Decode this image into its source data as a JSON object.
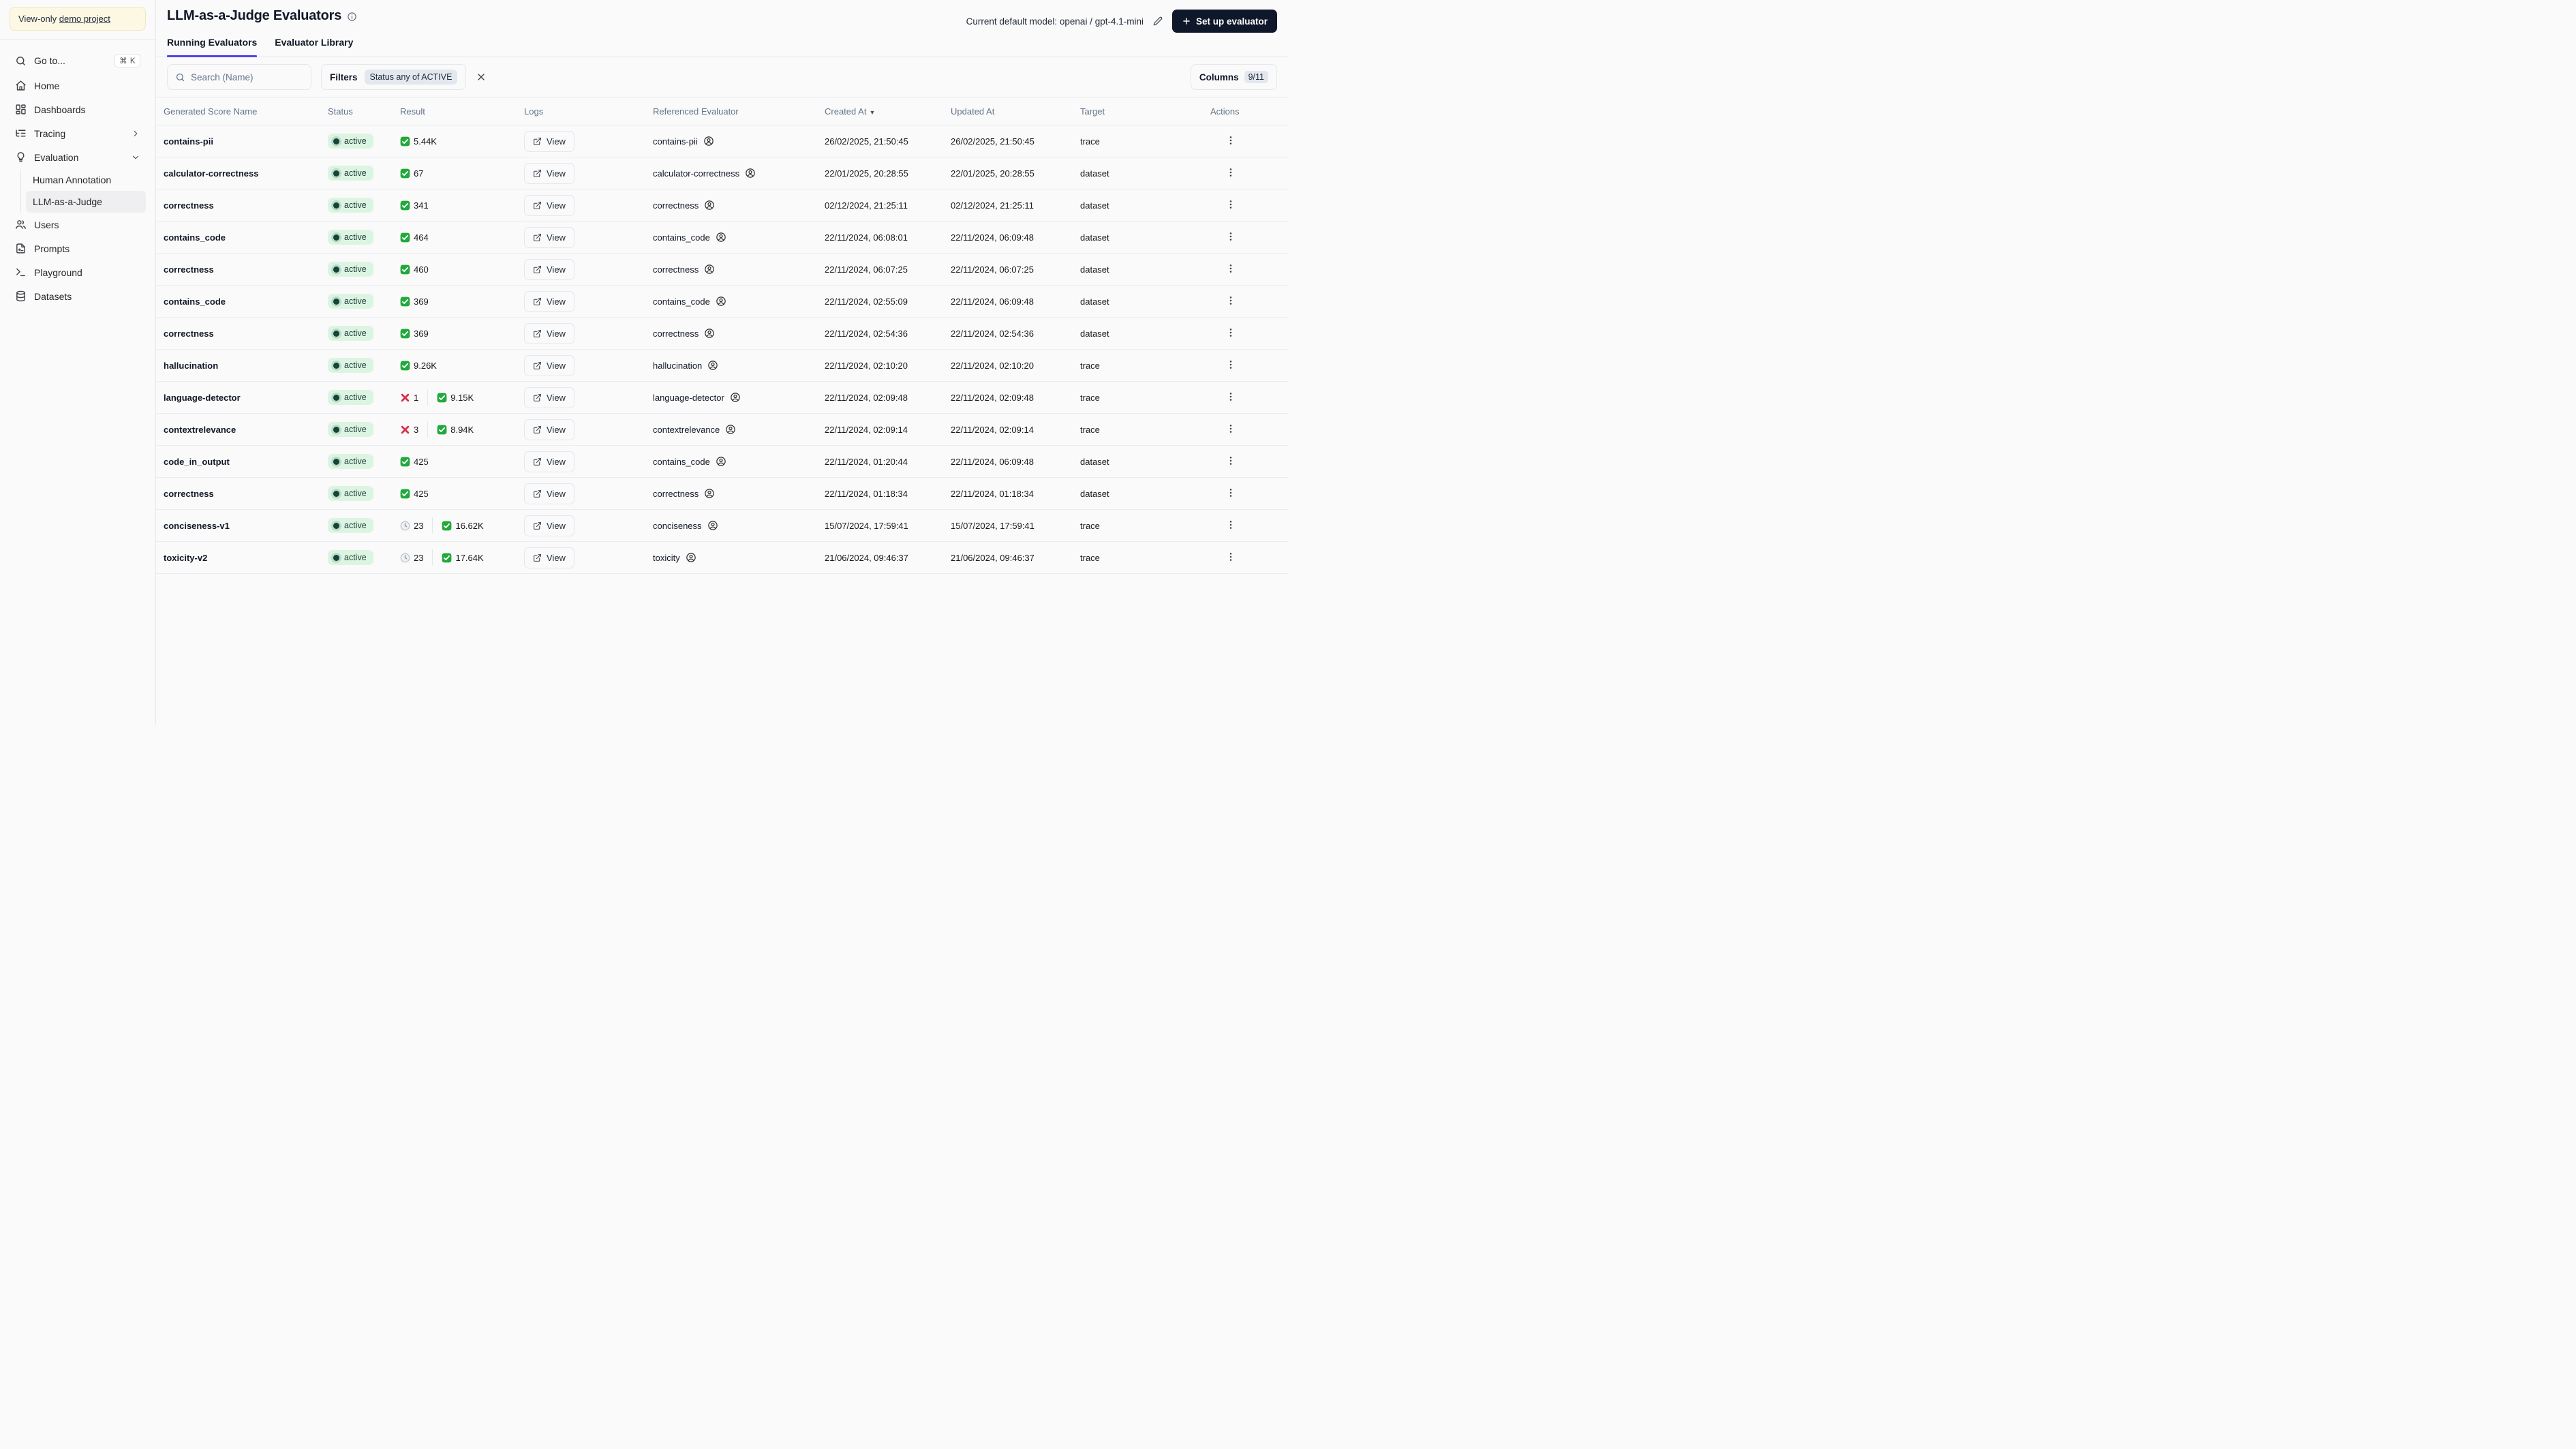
{
  "colors": {
    "accent": "#4f46e5",
    "primary_button_bg": "#0f172a",
    "status_badge_bg": "#dcf5e3",
    "status_dot": "#17433a",
    "result_check_green": "#23a83c",
    "result_cross_red": "#dd2e44",
    "banner_bg": "#fdf8e3",
    "pill_bg": "#e3e8ef"
  },
  "sidebar": {
    "banner": {
      "prefix": "View-only",
      "link_label": "demo project"
    },
    "items": [
      {
        "id": "goto",
        "label": "Go to...",
        "icon": "search",
        "shortcut": "⌘ K"
      },
      {
        "id": "home",
        "label": "Home",
        "icon": "home"
      },
      {
        "id": "dashboards",
        "label": "Dashboards",
        "icon": "dashboard"
      },
      {
        "id": "tracing",
        "label": "Tracing",
        "icon": "list-tree",
        "chevron": "right"
      },
      {
        "id": "evaluation",
        "label": "Evaluation",
        "icon": "lightbulb",
        "chevron": "down",
        "children": [
          {
            "id": "human-annotation",
            "label": "Human Annotation",
            "active": false
          },
          {
            "id": "llm-as-a-judge",
            "label": "LLM-as-a-Judge",
            "active": true
          }
        ]
      },
      {
        "id": "users",
        "label": "Users",
        "icon": "users"
      },
      {
        "id": "prompts",
        "label": "Prompts",
        "icon": "file"
      },
      {
        "id": "playground",
        "label": "Playground",
        "icon": "terminal"
      },
      {
        "id": "datasets",
        "label": "Datasets",
        "icon": "database"
      }
    ]
  },
  "header": {
    "title": "LLM-as-a-Judge Evaluators",
    "title_info_icon": "info",
    "model_label": "Current default model: openai / gpt-4.1-mini",
    "edit_icon": "pencil",
    "setup_button_icon": "plus",
    "setup_button_label": "Set up evaluator"
  },
  "tabs": [
    {
      "label": "Running Evaluators",
      "active": true
    },
    {
      "label": "Evaluator Library",
      "active": false
    }
  ],
  "toolbar": {
    "search_icon": "search",
    "search_placeholder": "Search (Name)",
    "filters_label": "Filters",
    "filter_badge": "Status any of ACTIVE",
    "clear_filter_icon": "x",
    "columns_label": "Columns",
    "columns_badge": "9/11"
  },
  "table": {
    "columns": [
      "Generated Score Name",
      "Status",
      "Result",
      "Logs",
      "Referenced Evaluator",
      "Created At",
      "Updated At",
      "Target",
      "Actions"
    ],
    "sort_column": "Created At",
    "sort_indicator": "▼",
    "logs_button_label": "View",
    "rows": [
      {
        "name": "contains-pii",
        "status": "active",
        "result": [
          {
            "icon": "check",
            "value": "5.44K"
          }
        ],
        "referenced": "contains-pii",
        "created": "26/02/2025, 21:50:45",
        "updated": "26/02/2025, 21:50:45",
        "target": "trace"
      },
      {
        "name": "calculator-correctness",
        "status": "active",
        "result": [
          {
            "icon": "check",
            "value": "67"
          }
        ],
        "referenced": "calculator-correctness",
        "created": "22/01/2025, 20:28:55",
        "updated": "22/01/2025, 20:28:55",
        "target": "dataset"
      },
      {
        "name": "correctness",
        "status": "active",
        "result": [
          {
            "icon": "check",
            "value": "341"
          }
        ],
        "referenced": "correctness",
        "created": "02/12/2024, 21:25:11",
        "updated": "02/12/2024, 21:25:11",
        "target": "dataset"
      },
      {
        "name": "contains_code",
        "status": "active",
        "result": [
          {
            "icon": "check",
            "value": "464"
          }
        ],
        "referenced": "contains_code",
        "created": "22/11/2024, 06:08:01",
        "updated": "22/11/2024, 06:09:48",
        "target": "dataset"
      },
      {
        "name": "correctness",
        "status": "active",
        "result": [
          {
            "icon": "check",
            "value": "460"
          }
        ],
        "referenced": "correctness",
        "created": "22/11/2024, 06:07:25",
        "updated": "22/11/2024, 06:07:25",
        "target": "dataset"
      },
      {
        "name": "contains_code",
        "status": "active",
        "result": [
          {
            "icon": "check",
            "value": "369"
          }
        ],
        "referenced": "contains_code",
        "created": "22/11/2024, 02:55:09",
        "updated": "22/11/2024, 06:09:48",
        "target": "dataset"
      },
      {
        "name": "correctness",
        "status": "active",
        "result": [
          {
            "icon": "check",
            "value": "369"
          }
        ],
        "referenced": "correctness",
        "created": "22/11/2024, 02:54:36",
        "updated": "22/11/2024, 02:54:36",
        "target": "dataset"
      },
      {
        "name": "hallucination",
        "status": "active",
        "result": [
          {
            "icon": "check",
            "value": "9.26K"
          }
        ],
        "referenced": "hallucination",
        "created": "22/11/2024, 02:10:20",
        "updated": "22/11/2024, 02:10:20",
        "target": "trace"
      },
      {
        "name": "language-detector",
        "status": "active",
        "result": [
          {
            "icon": "cross",
            "value": "1"
          },
          {
            "icon": "check",
            "value": "9.15K"
          }
        ],
        "referenced": "language-detector",
        "created": "22/11/2024, 02:09:48",
        "updated": "22/11/2024, 02:09:48",
        "target": "trace"
      },
      {
        "name": "contextrelevance",
        "status": "active",
        "result": [
          {
            "icon": "cross",
            "value": "3"
          },
          {
            "icon": "check",
            "value": "8.94K"
          }
        ],
        "referenced": "contextrelevance",
        "created": "22/11/2024, 02:09:14",
        "updated": "22/11/2024, 02:09:14",
        "target": "trace"
      },
      {
        "name": "code_in_output",
        "status": "active",
        "result": [
          {
            "icon": "check",
            "value": "425"
          }
        ],
        "referenced": "contains_code",
        "created": "22/11/2024, 01:20:44",
        "updated": "22/11/2024, 06:09:48",
        "target": "dataset"
      },
      {
        "name": "correctness",
        "status": "active",
        "result": [
          {
            "icon": "check",
            "value": "425"
          }
        ],
        "referenced": "correctness",
        "created": "22/11/2024, 01:18:34",
        "updated": "22/11/2024, 01:18:34",
        "target": "dataset"
      },
      {
        "name": "conciseness-v1",
        "status": "active",
        "result": [
          {
            "icon": "clock",
            "value": "23"
          },
          {
            "icon": "check",
            "value": "16.62K"
          }
        ],
        "referenced": "conciseness",
        "created": "15/07/2024, 17:59:41",
        "updated": "15/07/2024, 17:59:41",
        "target": "trace"
      },
      {
        "name": "toxicity-v2",
        "status": "active",
        "result": [
          {
            "icon": "clock",
            "value": "23"
          },
          {
            "icon": "check",
            "value": "17.64K"
          }
        ],
        "referenced": "toxicity",
        "created": "21/06/2024, 09:46:37",
        "updated": "21/06/2024, 09:46:37",
        "target": "trace"
      }
    ]
  }
}
